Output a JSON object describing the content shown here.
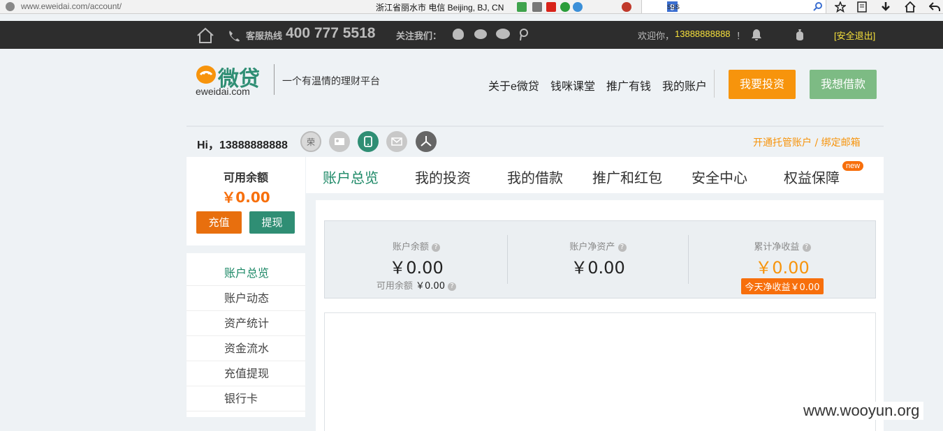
{
  "browser": {
    "url": "www.eweidai.com/account/",
    "location": "浙江省丽水市 电信   Beijing, BJ, CN",
    "search_text": "sss"
  },
  "topbar": {
    "hotline_label": "客服热线",
    "hotline_number": "400 777 5518",
    "follow_label": "关注我们：",
    "welcome": "欢迎你，",
    "phone": "13888888888",
    "exclaim": "！",
    "logout": "[安全退出]"
  },
  "logo": {
    "brand": "微贷",
    "domain": "eweidai.com",
    "slogan": "一个有温情的理财平台"
  },
  "nav": {
    "items": [
      "关于e微贷",
      "钱咪课堂",
      "推广有钱",
      "我的账户"
    ],
    "invest_btn": "我要投资",
    "borrow_btn": "我想借款"
  },
  "user": {
    "greeting": "Hi，13888888888",
    "badge_rong": "荣",
    "open_account": "开通托管账户 / 绑定邮箱"
  },
  "balance": {
    "label": "可用余额",
    "amount": "￥0.00",
    "recharge": "充值",
    "withdraw": "提现"
  },
  "sidebar": {
    "items": [
      "账户总览",
      "账户动态",
      "资产统计",
      "资金流水",
      "充值提现",
      "银行卡"
    ]
  },
  "tabs": {
    "items": [
      "账户总览",
      "我的投资",
      "我的借款",
      "推广和红包",
      "安全中心",
      "权益保障"
    ],
    "new_badge": "new"
  },
  "stats": {
    "balance_label": "账户余额",
    "balance_value": "￥0.00",
    "available_label": "可用余额",
    "available_value": "￥0.00",
    "net_assets_label": "账户净资产",
    "net_assets_value": "￥0.00",
    "earnings_label": "累计净收益",
    "earnings_value": "￥0.00",
    "today_earnings": "今天净收益￥0.00"
  },
  "watermark": "www.wooyun.org",
  "colors": {
    "accent_green": "#1c8866",
    "accent_orange": "#f7940c",
    "topbar_bg": "#2d2d2d"
  }
}
